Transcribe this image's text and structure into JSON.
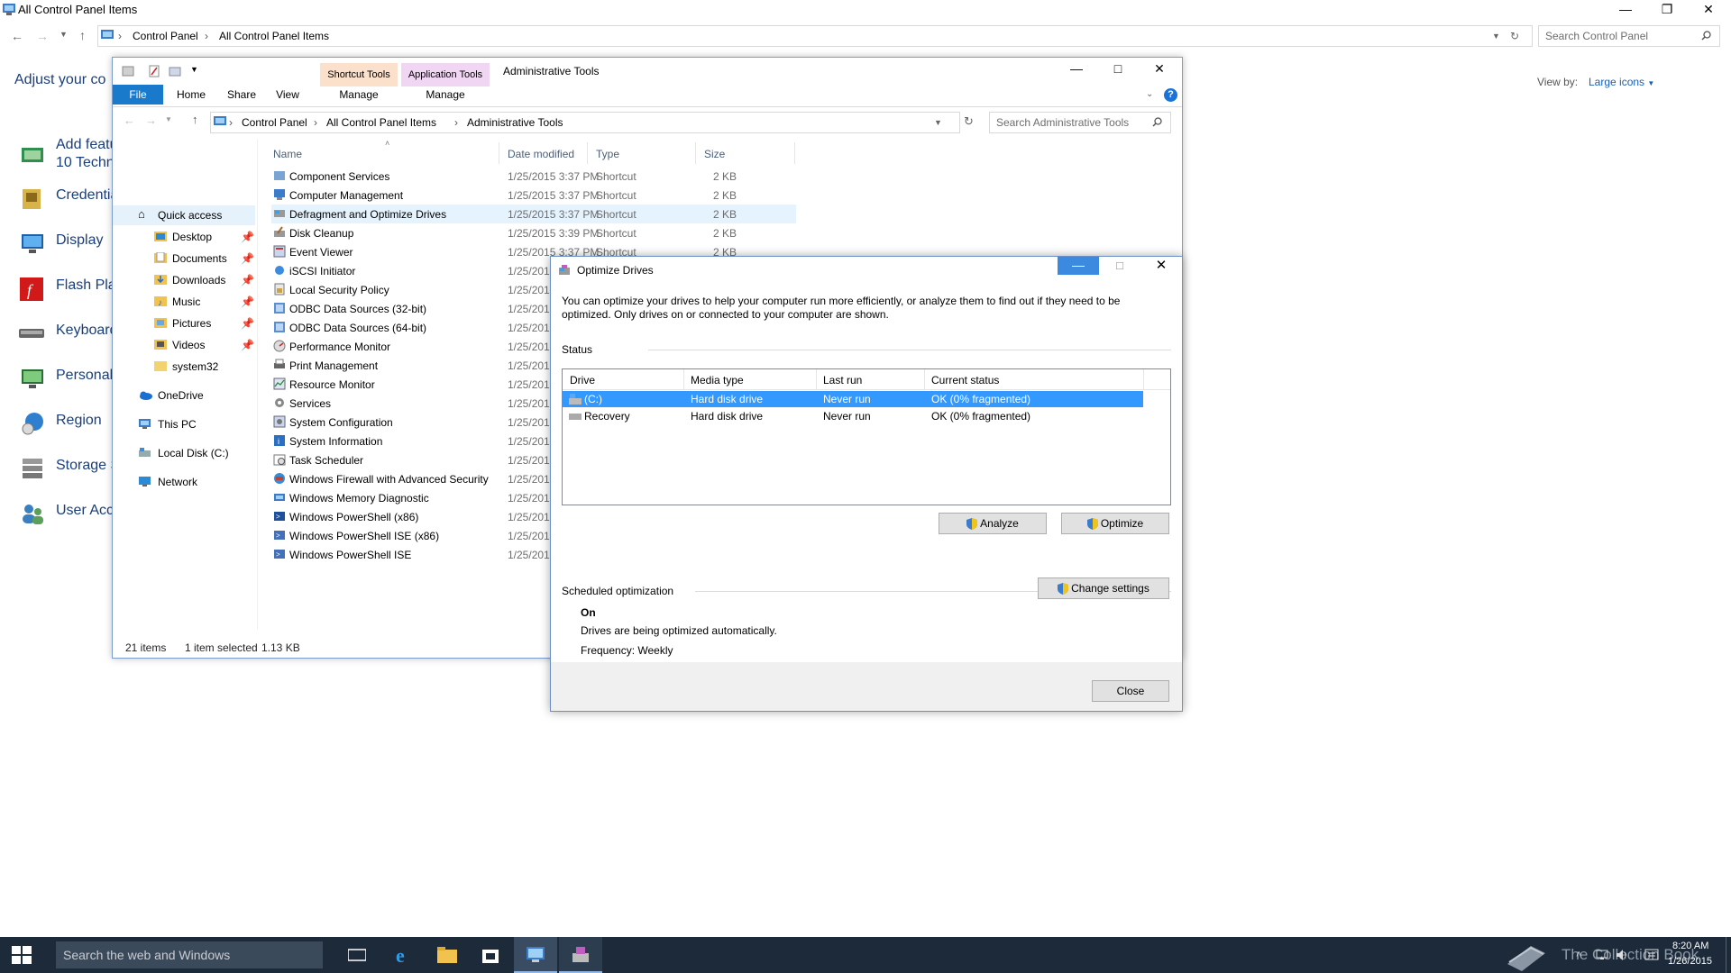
{
  "bg_window": {
    "title": "All Control Panel Items",
    "breadcrumb": [
      "Control Panel",
      "All Control Panel Items"
    ],
    "search_placeholder": "Search Control Panel",
    "heading": "Adjust your co",
    "view_by_label": "View by:",
    "view_by_value": "Large icons",
    "items": [
      {
        "label": "Add featu",
        "label2": "10 Techn"
      },
      {
        "label": "Credentia"
      },
      {
        "label": "Display"
      },
      {
        "label": "Flash Pla"
      },
      {
        "label": "Keyboard"
      },
      {
        "label": "Personali"
      },
      {
        "label": "Region"
      },
      {
        "label": "Storage S"
      },
      {
        "label": "User Acc"
      }
    ]
  },
  "explorer": {
    "context_tabs": {
      "shortcut": "Shortcut Tools",
      "application": "Application Tools",
      "title": "Administrative Tools"
    },
    "ribbon_tabs": {
      "file": "File",
      "home": "Home",
      "share": "Share",
      "view": "View",
      "manage1": "Manage",
      "manage2": "Manage"
    },
    "breadcrumb": [
      "Control Panel",
      "All Control Panel Items",
      "Administrative Tools"
    ],
    "search_placeholder": "Search Administrative Tools",
    "nav": {
      "quick_access": "Quick access",
      "desktop": "Desktop",
      "documents": "Documents",
      "downloads": "Downloads",
      "music": "Music",
      "pictures": "Pictures",
      "videos": "Videos",
      "system32": "system32",
      "onedrive": "OneDrive",
      "this_pc": "This PC",
      "local_disk": "Local Disk (C:)",
      "network": "Network"
    },
    "columns": {
      "name": "Name",
      "date": "Date modified",
      "type": "Type",
      "size": "Size"
    },
    "files": [
      {
        "name": "Component Services",
        "date": "1/25/2015 3:37 PM",
        "type": "Shortcut",
        "size": "2 KB"
      },
      {
        "name": "Computer Management",
        "date": "1/25/2015 3:37 PM",
        "type": "Shortcut",
        "size": "2 KB"
      },
      {
        "name": "Defragment and Optimize Drives",
        "date": "1/25/2015 3:37 PM",
        "type": "Shortcut",
        "size": "2 KB"
      },
      {
        "name": "Disk Cleanup",
        "date": "1/25/2015 3:39 PM",
        "type": "Shortcut",
        "size": "2 KB"
      },
      {
        "name": "Event Viewer",
        "date": "1/25/2015 3:37 PM",
        "type": "Shortcut",
        "size": "2 KB"
      },
      {
        "name": "iSCSI Initiator",
        "date": "1/25/201",
        "type": "",
        "size": ""
      },
      {
        "name": "Local Security Policy",
        "date": "1/25/201",
        "type": "",
        "size": ""
      },
      {
        "name": "ODBC Data Sources (32-bit)",
        "date": "1/25/201",
        "type": "",
        "size": ""
      },
      {
        "name": "ODBC Data Sources (64-bit)",
        "date": "1/25/201",
        "type": "",
        "size": ""
      },
      {
        "name": "Performance Monitor",
        "date": "1/25/201",
        "type": "",
        "size": ""
      },
      {
        "name": "Print Management",
        "date": "1/25/201",
        "type": "",
        "size": ""
      },
      {
        "name": "Resource Monitor",
        "date": "1/25/201",
        "type": "",
        "size": ""
      },
      {
        "name": "Services",
        "date": "1/25/201",
        "type": "",
        "size": ""
      },
      {
        "name": "System Configuration",
        "date": "1/25/201",
        "type": "",
        "size": ""
      },
      {
        "name": "System Information",
        "date": "1/25/201",
        "type": "",
        "size": ""
      },
      {
        "name": "Task Scheduler",
        "date": "1/25/201",
        "type": "",
        "size": ""
      },
      {
        "name": "Windows Firewall with Advanced Security",
        "date": "1/25/201",
        "type": "",
        "size": ""
      },
      {
        "name": "Windows Memory Diagnostic",
        "date": "1/25/201",
        "type": "",
        "size": ""
      },
      {
        "name": "Windows PowerShell (x86)",
        "date": "1/25/201",
        "type": "",
        "size": ""
      },
      {
        "name": "Windows PowerShell ISE (x86)",
        "date": "1/25/201",
        "type": "",
        "size": ""
      },
      {
        "name": "Windows PowerShell ISE",
        "date": "1/25/201",
        "type": "",
        "size": ""
      }
    ],
    "status": {
      "count": "21 items",
      "selected": "1 item selected",
      "size": "1.13 KB"
    }
  },
  "dialog": {
    "title": "Optimize Drives",
    "description": "You can optimize your drives to help your computer run more efficiently, or analyze them to find out if they need to be optimized. Only drives on or connected to your computer are shown.",
    "status_label": "Status",
    "columns": {
      "drive": "Drive",
      "media": "Media type",
      "last_run": "Last run",
      "status": "Current status"
    },
    "drives": [
      {
        "drive": "(C:)",
        "media": "Hard disk drive",
        "last_run": "Never run",
        "status": "OK (0% fragmented)"
      },
      {
        "drive": "Recovery",
        "media": "Hard disk drive",
        "last_run": "Never run",
        "status": "OK (0% fragmented)"
      }
    ],
    "analyze": "Analyze",
    "optimize": "Optimize",
    "scheduled_label": "Scheduled optimization",
    "sched_state": "On",
    "sched_desc": "Drives are being optimized automatically.",
    "sched_freq": "Frequency: Weekly",
    "change_settings": "Change settings",
    "close": "Close"
  },
  "taskbar": {
    "search_placeholder": "Search the web and Windows",
    "watermark": "The Collection Book",
    "time": "8:20 AM",
    "date": "1/26/2015"
  },
  "colors": {
    "selection": "#3399ff",
    "accent": "#1979ca",
    "taskbar": "#1c2a3a"
  }
}
